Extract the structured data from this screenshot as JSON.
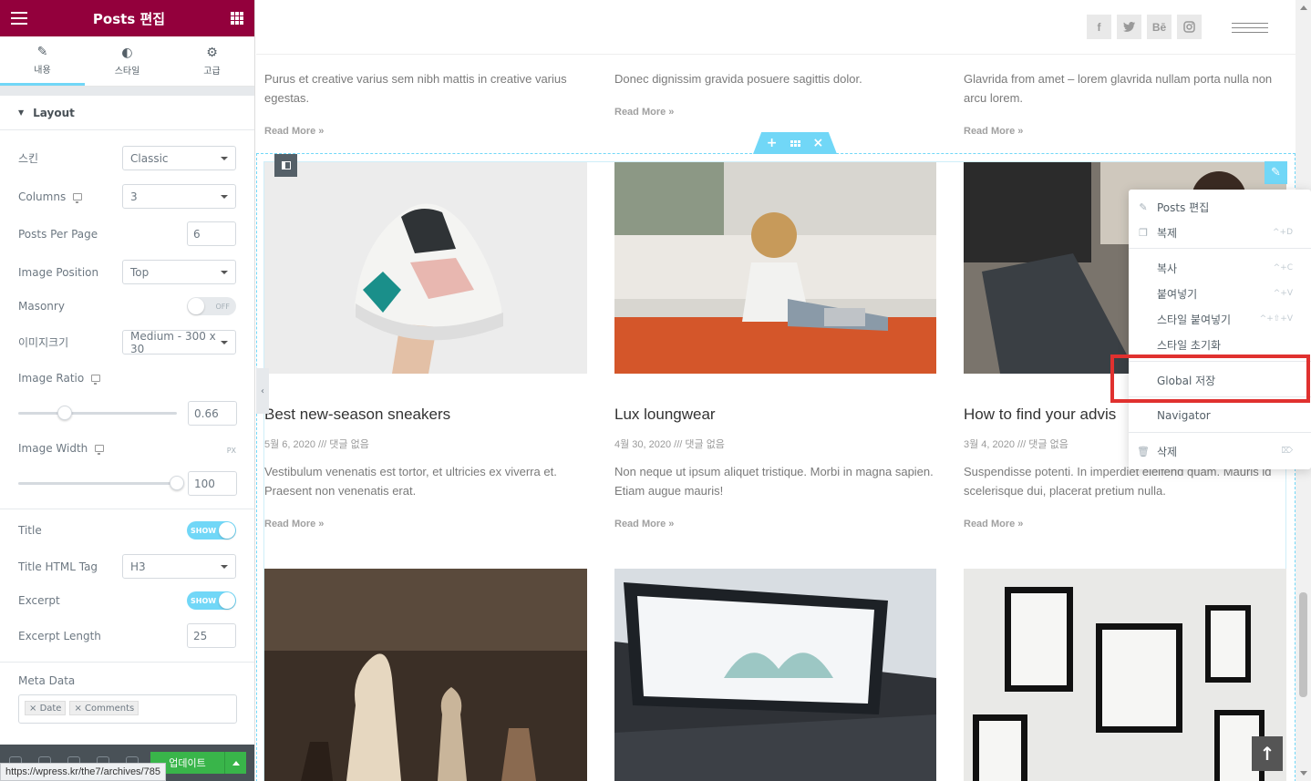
{
  "panel": {
    "title": "Posts 편집",
    "tabs": [
      {
        "label": "내용",
        "icon": "pencil-icon"
      },
      {
        "label": "스타일",
        "icon": "contrast-icon"
      },
      {
        "label": "고급",
        "icon": "gear-icon"
      }
    ],
    "section": "Layout",
    "controls": {
      "skin": {
        "label": "스킨",
        "value": "Classic"
      },
      "columns": {
        "label": "Columns",
        "value": "3"
      },
      "posts_per_page": {
        "label": "Posts Per Page",
        "value": "6"
      },
      "image_position": {
        "label": "Image Position",
        "value": "Top"
      },
      "masonry": {
        "label": "Masonry",
        "state": "OFF"
      },
      "image_size": {
        "label": "이미지크기",
        "value": "Medium - 300 x 30"
      },
      "image_ratio": {
        "label": "Image Ratio",
        "value": "0.66"
      },
      "image_width": {
        "label": "Image Width",
        "value": "100",
        "unit": "PX"
      },
      "title": {
        "label": "Title",
        "state": "SHOW"
      },
      "title_tag": {
        "label": "Title HTML Tag",
        "value": "H3"
      },
      "excerpt": {
        "label": "Excerpt",
        "state": "SHOW"
      },
      "excerpt_length": {
        "label": "Excerpt Length",
        "value": "25"
      },
      "meta_data": {
        "label": "Meta Data",
        "chips": [
          "Date",
          "Comments"
        ]
      }
    },
    "footer": {
      "update_label": "업데이트"
    },
    "status_url": "https://wpress.kr/the7/archives/785"
  },
  "social": [
    "f",
    "t",
    "Bē",
    "ig"
  ],
  "top_row": [
    {
      "excerpt": "Purus et creative varius sem nibh mattis in creative varius egestas.",
      "read_more": "Read More »"
    },
    {
      "excerpt": "Donec dignissim gravida posuere sagittis dolor.",
      "read_more": "Read More »"
    },
    {
      "excerpt": "Glavrida from amet – lorem glavrida nullam porta nulla non arcu lorem.",
      "read_more": "Read More »"
    }
  ],
  "posts": [
    {
      "title": "Best new-season sneakers",
      "meta": "5월 6, 2020 /// 댓글 없음",
      "excerpt": "Vestibulum venenatis est tortor, et ultricies ex viverra et. Praesent non venenatis erat.",
      "read_more": "Read More »"
    },
    {
      "title": "Lux loungwear",
      "meta": "4월 30, 2020 /// 댓글 없음",
      "excerpt": "Non neque ut ipsum aliquet tristique. Morbi in magna sapien. Etiam augue mauris!",
      "read_more": "Read More »"
    },
    {
      "title": "How to find your advis",
      "meta": "3월 4, 2020 /// 댓글 없음",
      "excerpt": "Suspendisse potenti. In imperdiet eleifend quam. Mauris id scelerisque dui, placerat pretium nulla.",
      "read_more": "Read More »"
    }
  ],
  "context_menu": {
    "items": [
      {
        "label": "Posts 편집",
        "shortcut": ""
      },
      {
        "label": "복제",
        "shortcut": "^+D"
      },
      {
        "label": "복사",
        "shortcut": "^+C"
      },
      {
        "label": "붙여넣기",
        "shortcut": "^+V"
      },
      {
        "label": "스타일 붙여넣기",
        "shortcut": "^+⇧+V"
      },
      {
        "label": "스타일 초기화",
        "shortcut": ""
      },
      {
        "label": "Global 저장",
        "shortcut": ""
      },
      {
        "label": "Navigator",
        "shortcut": ""
      },
      {
        "label": "삭제",
        "shortcut": "⌦"
      }
    ]
  },
  "colors": {
    "brand": "#93003c",
    "accent": "#71d7f7",
    "update": "#39b54a",
    "highlight": "#e0312f"
  }
}
